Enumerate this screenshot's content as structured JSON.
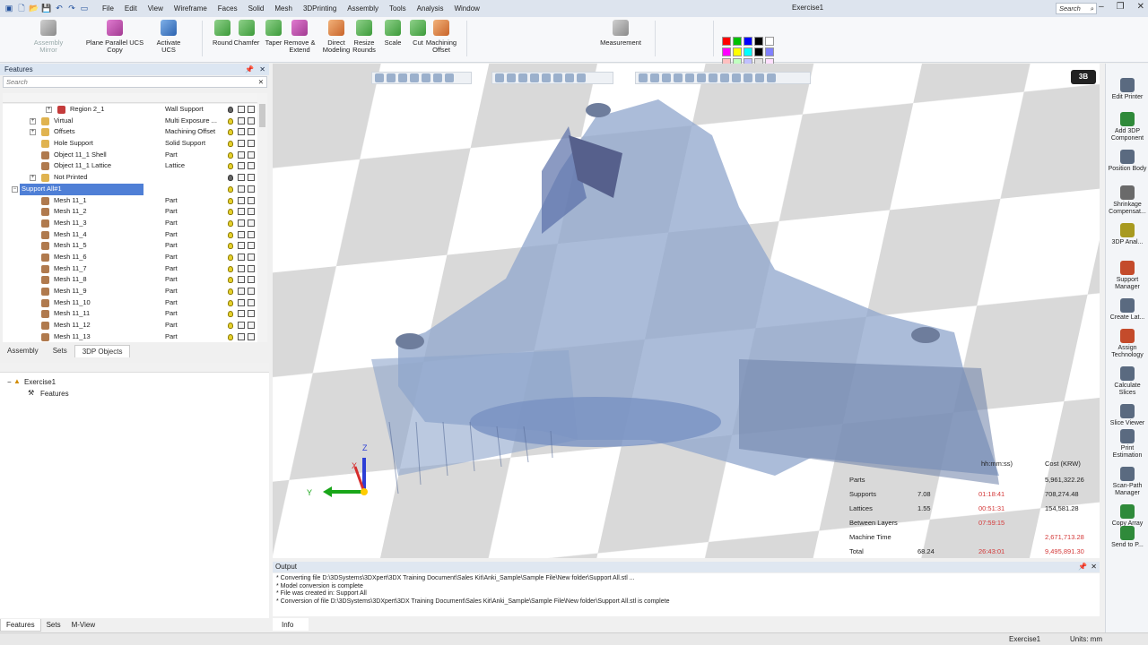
{
  "window": {
    "title": "Exercise1",
    "search_placeholder": "Search",
    "menu": [
      "File",
      "Edit",
      "View",
      "Wireframe",
      "Faces",
      "Solid",
      "Mesh",
      "3DPrinting",
      "Assembly",
      "Tools",
      "Analysis",
      "Window"
    ]
  },
  "ribbon": {
    "buttons": [
      {
        "label": "Assembly Mirror",
        "icon": "mirror-icon",
        "disabled": true
      },
      {
        "label": "Plane Parallel UCS Copy",
        "icon": "plane-parallel-icon"
      },
      {
        "label": "Activate UCS",
        "icon": "activate-ucs-icon"
      },
      {
        "label": "Round",
        "icon": "round-icon"
      },
      {
        "label": "Chamfer",
        "icon": "chamfer-icon"
      },
      {
        "label": "Taper",
        "icon": "taper-icon"
      },
      {
        "label": "Remove & Extend",
        "icon": "remove-extend-icon"
      },
      {
        "label": "Direct Modeling",
        "icon": "direct-modeling-icon"
      },
      {
        "label": "Resize Rounds",
        "icon": "resize-rounds-icon"
      },
      {
        "label": "Scale",
        "icon": "scale-icon"
      },
      {
        "label": "Cut",
        "icon": "cut-icon"
      },
      {
        "label": "Machining Offset",
        "icon": "machining-offset-icon"
      },
      {
        "label": "Measurement",
        "icon": "measurement-icon"
      }
    ],
    "palette_colors": [
      "#ff0000",
      "#00c000",
      "#0000ff",
      "#000000",
      "#ffffff",
      "#ff00ff",
      "#ffff00",
      "#00ffff",
      "#000000",
      "#8080ff",
      "#ffc0c0",
      "#c0ffc0",
      "#c0c0ff",
      "#e0e0e0",
      "#ffe0ff"
    ]
  },
  "features_panel": {
    "title": "Features",
    "search_placeholder": "Search",
    "rows": [
      {
        "name": "Region 2_1",
        "type": "Wall Support",
        "indent": 3,
        "expand": "+",
        "icon_color": "#c43b3b"
      },
      {
        "name": "Virtual",
        "type": "Multi Exposure ...",
        "indent": 2,
        "expand": "+",
        "icon_color": "#e0b34f"
      },
      {
        "name": "Offsets",
        "type": "Machining Offset",
        "indent": 2,
        "expand": "+",
        "icon_color": "#e0b34f"
      },
      {
        "name": "Hole Support",
        "type": "Solid Support",
        "indent": 2,
        "expand": "",
        "icon_color": "#e0b34f"
      },
      {
        "name": "Object 11_1 Shell",
        "type": "Part",
        "indent": 2,
        "expand": "",
        "icon_color": "#b07a4e"
      },
      {
        "name": "Object 11_1 Lattice",
        "type": "Lattice",
        "indent": 2,
        "expand": "",
        "icon_color": "#b07a4e"
      },
      {
        "name": "Not Printed",
        "type": "",
        "indent": 2,
        "expand": "+",
        "icon_color": "#e0b34f"
      },
      {
        "name": "Support All#1",
        "type": "",
        "indent": 1,
        "expand": "-",
        "icon_color": "#3a7a3a",
        "selected": true
      },
      {
        "name": "Mesh 11_1",
        "type": "Part",
        "indent": 2,
        "expand": "",
        "icon_color": "#b07a4e"
      },
      {
        "name": "Mesh 11_2",
        "type": "Part",
        "indent": 2,
        "expand": "",
        "icon_color": "#b07a4e"
      },
      {
        "name": "Mesh 11_3",
        "type": "Part",
        "indent": 2,
        "expand": "",
        "icon_color": "#b07a4e"
      },
      {
        "name": "Mesh 11_4",
        "type": "Part",
        "indent": 2,
        "expand": "",
        "icon_color": "#b07a4e"
      },
      {
        "name": "Mesh 11_5",
        "type": "Part",
        "indent": 2,
        "expand": "",
        "icon_color": "#b07a4e"
      },
      {
        "name": "Mesh 11_6",
        "type": "Part",
        "indent": 2,
        "expand": "",
        "icon_color": "#b07a4e"
      },
      {
        "name": "Mesh 11_7",
        "type": "Part",
        "indent": 2,
        "expand": "",
        "icon_color": "#b07a4e"
      },
      {
        "name": "Mesh 11_8",
        "type": "Part",
        "indent": 2,
        "expand": "",
        "icon_color": "#b07a4e"
      },
      {
        "name": "Mesh 11_9",
        "type": "Part",
        "indent": 2,
        "expand": "",
        "icon_color": "#b07a4e"
      },
      {
        "name": "Mesh 11_10",
        "type": "Part",
        "indent": 2,
        "expand": "",
        "icon_color": "#b07a4e"
      },
      {
        "name": "Mesh 11_11",
        "type": "Part",
        "indent": 2,
        "expand": "",
        "icon_color": "#b07a4e"
      },
      {
        "name": "Mesh 11_12",
        "type": "Part",
        "indent": 2,
        "expand": "",
        "icon_color": "#b07a4e"
      },
      {
        "name": "Mesh 11_13",
        "type": "Part",
        "indent": 2,
        "expand": "",
        "icon_color": "#b07a4e"
      }
    ],
    "tabs": [
      "Assembly",
      "Sets",
      "3DP Objects"
    ],
    "active_tab": "3DP Objects"
  },
  "project_tree": {
    "root": "Exercise1",
    "child": "Features"
  },
  "bottom_tabs": [
    "Features",
    "Sets",
    "M-View"
  ],
  "viewport": {
    "axes": {
      "z": "Z",
      "y": "Y",
      "x": "X"
    },
    "logo": "3B",
    "stats": {
      "headers": {
        "time": "hh:mm:ss)",
        "cost": "Cost (KRW)"
      },
      "rows": [
        {
          "label": "Parts",
          "value": "",
          "time": "",
          "cost": "5,961,322.26"
        },
        {
          "label": "Supports",
          "value": "7.08",
          "time": "01:18:41",
          "cost": "708,274.48"
        },
        {
          "label": "Lattices",
          "value": "1.55",
          "time": "00:51:31",
          "cost": "154,581.28"
        },
        {
          "label": "Between Layers",
          "value": "",
          "time": "07:59:15",
          "cost": ""
        },
        {
          "label": "Machine Time",
          "value": "",
          "time": "",
          "cost": "2,671,713.28"
        },
        {
          "label": "Total",
          "value": "68.24",
          "time": "26:43:01",
          "cost": "9,495,891.30"
        }
      ]
    }
  },
  "output": {
    "title": "Output",
    "lines": [
      "* Converting file D:\\3DSystems\\3DXpert\\3DX Training Document\\Sales Kit\\Anki_Sample\\Sample File\\New folder\\Support All.stl ...",
      "* Model conversion is complete",
      "* File was created in: Support All",
      "* Conversion of file D:\\3DSystems\\3DXpert\\3DX Training Document\\Sales Kit\\Anki_Sample\\Sample File\\New folder\\Support All.stl is complete"
    ],
    "tab": "Info"
  },
  "right_panel": {
    "items": [
      {
        "label": "Edit Printer",
        "icon": "printer-icon"
      },
      {
        "label": "Add 3DP Component",
        "icon": "add-component-icon"
      },
      {
        "label": "Position Body",
        "icon": "position-body-icon"
      },
      {
        "label": "Shrinkage Compensat...",
        "icon": "shrinkage-icon"
      },
      {
        "label": "3DP Anal...",
        "icon": "analysis-icon"
      },
      {
        "label": "Support Manager",
        "icon": "support-manager-icon"
      },
      {
        "label": "Create Lat...",
        "icon": "lattice-icon"
      },
      {
        "label": "Assign Technology",
        "icon": "assign-technology-icon"
      },
      {
        "label": "Calculate Slices",
        "icon": "calculate-slices-icon"
      },
      {
        "label": "Slice Viewer",
        "icon": "slice-viewer-icon"
      },
      {
        "label": "Print Estimation",
        "icon": "print-estimation-icon"
      },
      {
        "label": "Scan-Path Manager",
        "icon": "scan-path-icon"
      },
      {
        "label": "Copy Array",
        "icon": "copy-array-icon"
      },
      {
        "label": "Send to P...",
        "icon": "send-to-printer-icon"
      }
    ]
  },
  "status_bar": {
    "document": "Exercise1",
    "units": "Units: mm"
  }
}
